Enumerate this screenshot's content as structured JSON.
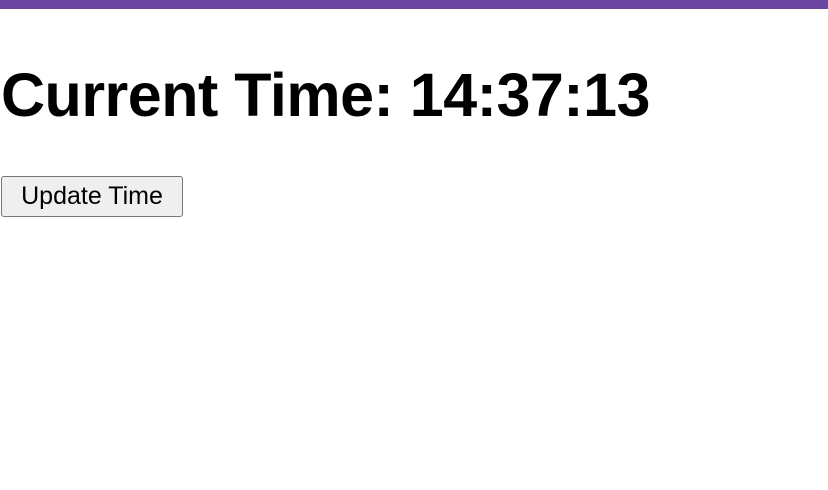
{
  "theme": {
    "accent_bar_color": "#6a46a0"
  },
  "heading": {
    "label": "Current Time:",
    "time": "14:37:13"
  },
  "actions": {
    "update_label": "Update Time"
  }
}
